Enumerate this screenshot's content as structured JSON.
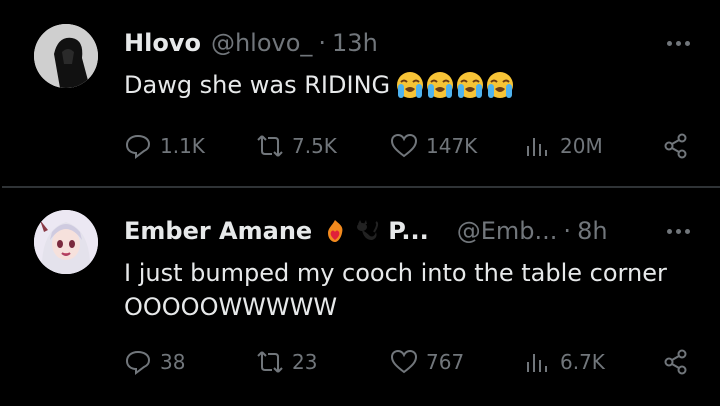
{
  "tweets": [
    {
      "name": "Hlovo",
      "handle": "@hlovo_",
      "time": "13h",
      "text": "Dawg she was RIDING",
      "emojis": [
        "loudly-crying-face",
        "loudly-crying-face",
        "loudly-crying-face",
        "loudly-crying-face"
      ],
      "replies": "1.1K",
      "retweets": "7.5K",
      "likes": "147K",
      "views": "20M"
    },
    {
      "name": "Ember Amane",
      "name_badges": [
        "heart-on-fire-emoji",
        "black-cat-emoji"
      ],
      "name_trunc": "P...",
      "handle": "@Emb...",
      "time": "8h",
      "text": "I just bumped my cooch into the table corner OOOOOWWWWW",
      "replies": "38",
      "retweets": "23",
      "likes": "767",
      "views": "6.7K"
    }
  ],
  "colors": {
    "background": "#000000",
    "text": "#e7e9ea",
    "muted": "#71767b",
    "divider": "#2f3336"
  }
}
